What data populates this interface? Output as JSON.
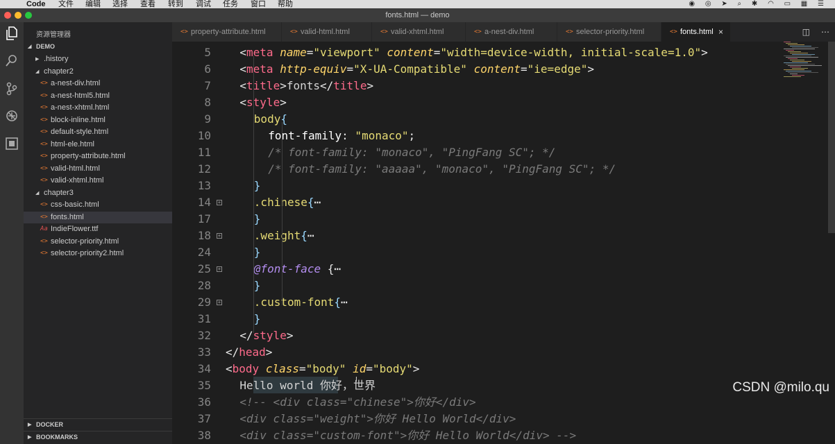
{
  "menubar": {
    "app": "Code",
    "items": [
      "文件",
      "编辑",
      "选择",
      "查看",
      "转到",
      "调试",
      "任务",
      "窗口",
      "帮助"
    ]
  },
  "window": {
    "title": "fonts.html — demo"
  },
  "sidebar": {
    "title": "资源管理器",
    "root": "DEMO",
    "tree": [
      {
        "label": ".history",
        "type": "folder",
        "expanded": false
      },
      {
        "label": "chapter2",
        "type": "folder",
        "expanded": true
      },
      {
        "label": "a-nest-div.html",
        "type": "file"
      },
      {
        "label": "a-nest-html5.html",
        "type": "file"
      },
      {
        "label": "a-nest-xhtml.html",
        "type": "file"
      },
      {
        "label": "block-inline.html",
        "type": "file"
      },
      {
        "label": "default-style.html",
        "type": "file"
      },
      {
        "label": "html-ele.html",
        "type": "file"
      },
      {
        "label": "property-attribute.html",
        "type": "file"
      },
      {
        "label": "valid-html.html",
        "type": "file"
      },
      {
        "label": "valid-xhtml.html",
        "type": "file"
      },
      {
        "label": "chapter3",
        "type": "folder",
        "expanded": true
      },
      {
        "label": "css-basic.html",
        "type": "file"
      },
      {
        "label": "fonts.html",
        "type": "file",
        "selected": true
      },
      {
        "label": "IndieFlower.ttf",
        "type": "ttf"
      },
      {
        "label": "selector-priority.html",
        "type": "file"
      },
      {
        "label": "selector-priority2.html",
        "type": "file"
      }
    ],
    "bottom_sections": [
      "DOCKER",
      "BOOKMARKS"
    ]
  },
  "tabs": [
    {
      "label": "property-attribute.html",
      "active": false
    },
    {
      "label": "valid-html.html",
      "active": false
    },
    {
      "label": "valid-xhtml.html",
      "active": false
    },
    {
      "label": "a-nest-div.html",
      "active": false
    },
    {
      "label": "selector-priority.html",
      "active": false
    },
    {
      "label": "fonts.html",
      "active": true,
      "close": "×"
    }
  ],
  "editor": {
    "lines": [
      {
        "n": "5",
        "fold": false
      },
      {
        "n": "6",
        "fold": false
      },
      {
        "n": "7",
        "fold": false
      },
      {
        "n": "8",
        "fold": false
      },
      {
        "n": "9",
        "fold": false
      },
      {
        "n": "10",
        "fold": false
      },
      {
        "n": "11",
        "fold": false
      },
      {
        "n": "12",
        "fold": false
      },
      {
        "n": "13",
        "fold": false
      },
      {
        "n": "14",
        "fold": true
      },
      {
        "n": "17",
        "fold": false
      },
      {
        "n": "18",
        "fold": true
      },
      {
        "n": "24",
        "fold": false
      },
      {
        "n": "25",
        "fold": true
      },
      {
        "n": "28",
        "fold": false
      },
      {
        "n": "29",
        "fold": true
      },
      {
        "n": "31",
        "fold": false
      },
      {
        "n": "32",
        "fold": false
      },
      {
        "n": "33",
        "fold": false
      },
      {
        "n": "34",
        "fold": false
      },
      {
        "n": "35",
        "fold": false
      },
      {
        "n": "36",
        "fold": false
      },
      {
        "n": "37",
        "fold": false
      },
      {
        "n": "38",
        "fold": false
      }
    ],
    "code": [
      "<meta name=\"viewport\" content=\"width=device-width, initial-scale=1.0\">",
      "<meta http-equiv=\"X-UA-Compatible\" content=\"ie=edge\">",
      "<title>fonts</title>",
      "<style>",
      "body{",
      "font-family: \"monaco\";",
      "/* font-family: \"monaco\", \"PingFang SC\"; */",
      "/* font-family: \"aaaaa\", \"monaco\", \"PingFang SC\"; */",
      "}",
      ".chinese{⋯",
      "}",
      ".weight{⋯",
      "}",
      "@font-face {⋯",
      "}",
      ".custom-font{⋯",
      "}",
      "</style>",
      "</head>",
      "<body class=\"body\" id=\"body\">",
      "Hello world 你好，世界",
      "<!-- <div class=\"chinese\">你好</div>",
      "<div class=\"weight\">你好 Hello World</div>",
      "<div class=\"custom-font\">你好 Hello World</div> -->"
    ]
  },
  "watermark": "CSDN @milo.qu"
}
